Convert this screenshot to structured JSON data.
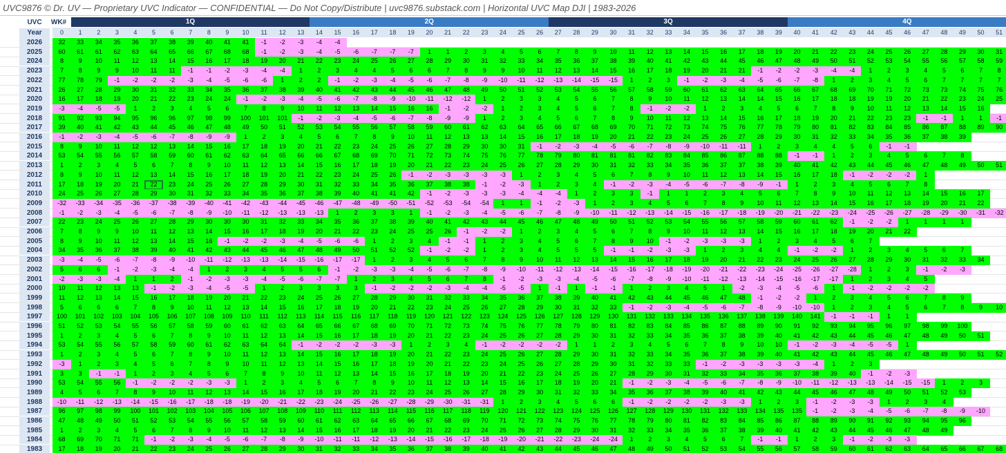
{
  "title": "UVC9876 © Dr. UV — Proprietary UVC Indicator — CONFIDENTIAL — Do Not Copy/Distribute | uvc9876.substack.com  |  Horizontal UVC Map DJI | 1983-2026",
  "header": {
    "uvc": "UVC",
    "wk": "WK#",
    "year": "Year"
  },
  "colors": {
    "positive": "#00ff00",
    "negative": "#ffa6ff",
    "quarter_dark": "#1f3864",
    "quarter_light": "#3a7cc4"
  },
  "quarters": [
    "1Q",
    "2Q",
    "3Q",
    "4Q"
  ],
  "weeks": [
    "0",
    "1",
    "2",
    "3",
    "4",
    "5",
    "6",
    "7",
    "8",
    "9",
    "10",
    "11",
    "12",
    "13",
    "14",
    "15",
    "16",
    "17",
    "18",
    "19",
    "20",
    "21",
    "22",
    "23",
    "24",
    "25",
    "26",
    "27",
    "28",
    "29",
    "30",
    "31",
    "32",
    "33",
    "34",
    "35",
    "36",
    "37",
    "38",
    "39",
    "40",
    "41",
    "42",
    "43",
    "44",
    "45",
    "46",
    "47",
    "48",
    "49",
    "50",
    "51",
    "52"
  ],
  "rows": [
    {
      "year": "2026",
      "values": "32 33 34 35 36 37 38 39 40 41 41 -1 -2 -3 -4 -4"
    },
    {
      "year": "2025",
      "values": "60 61 61 62 63 64 65 66 67 68 68 -1 -2 -3 -4 -5 -6 -7 -7 -7 1 1 2 3 4 5 6 7 8 9 10 11 12 13 14 15 16 17 18 19 20 21 22 23 24 25 26 27 28 29 30 31 32"
    },
    {
      "year": "2024",
      "values": "8 9 10 11 12 13 14 15 16 17 18 19 20 21 22 23 24 25 26 27 28 29 30 31 32 33 34 35 36 37 38 39 40 41 42 43 44 45 46 47 48 49 50 51 52 53 54 55 56 57 58 59 60"
    },
    {
      "year": "2023",
      "values": "7 8 9 9 10 11 11 -1 -1 -2 -3 -4 -4 1 2 3 4 4 5 6 6 7 8 9 9 10 11 12 13 14 15 16 17 18 19 20 21 21 -1 -2 -2 -3 -4 -4 1 2 3 4 5 6 7 8"
    },
    {
      "year": "2022",
      "values": "77 78 79 -1 -2 -2 -2 -3 -4 -5 -6 -6 1 2 2 -1 -2 -3 -4 -5 -6 -7 -8 -9 -10 -11 -12 -13 -14 -15 -15 1 2 3 -1 -2 -3 -4 -5 -6 -7 -8 1 2 3 4 5 6 7 7 7 7"
    },
    {
      "year": "2021",
      "values": "26 27 28 29 30 31 32 33 34 35 36 37 38 39 40 41 42 43 44 45 46 47 48 49 50 51 52 53 54 55 56 57 58 59 60 61 62 63 64 65 66 67 68 69 70 71 72 73 73 74 75 76 77"
    },
    {
      "year": "2020",
      "values": "16 17 18 19 20 21 22 23 24 24 -1 -2 -3 -4 -5 -6 -7 -8 -9 -10 -11 -12 -12 1 2 3 3 4 5 6 7 8 9 10 11 12 13 14 14 15 16 17 18 18 19 19 20 21 22 23 24 25 26"
    },
    {
      "year": "2019",
      "values": "-3 -4 -5 -5 1 2 3 4 5 6 7 8 9 10 11 12 13 14 15 16 16 -1 -2 -2 1 2 3 4 5 6 7 8 -1 -2 -2 1 2 3 4 5 6 7 8 9 10 11 12 13 14 15 16"
    },
    {
      "year": "2018",
      "values": "91 92 93 94 95 96 96 97 98 99 100 101 101 -1 -2 -3 -4 -5 -6 -7 -8 -9 -9 1 2 3 4 5 6 7 8 9 10 11 12 13 14 15 16 17 18 19 20 21 22 23 23 -1 -1 1 1 -1 -2 -3"
    },
    {
      "year": "2017",
      "values": "39 40 41 42 43 44 45 46 47 48 49 50 51 52 53 54 55 56 57 58 59 60 61 62 63 64 65 66 67 68 69 70 71 72 73 74 75 76 77 78 79 80 81 82 83 84 85 86 87 88 89 90 91"
    },
    {
      "year": "2016",
      "values": "-1 -2 -3 -4 -5 -6 -7 -8 -9 -9 1 2 3 4 5 6 7 8 9 10 11 12 13 13 14 15 16 17 18 19 20 21 22 23 24 25 26 27 28 29 30 31 32 33 34 35 36 37 38 39"
    },
    {
      "year": "2015",
      "values": "8 9 10 11 12 12 13 14 15 16 17 18 19 20 21 22 23 24 25 26 27 28 29 30 30 31 -1 -2 -3 -4 -5 -6 -7 -8 -9 -10 -11 -11 1 2 3 4 4 5 6 -1 -1"
    },
    {
      "year": "2014",
      "values": "53 54 55 56 57 58 59 60 61 62 63 64 65 66 66 67 68 69 70 71 72 73 74 75 76 77 78 79 80 81 81 81 82 83 84 85 86 87 88 88 -1 -1 1 2 3 4 5 6 7 8"
    },
    {
      "year": "2013",
      "values": "1 2 3 4 5 6 7 8 9 10 11 12 13 14 15 16 17 18 19 20 21 22 23 24 25 26 27 28 29 30 31 32 33 34 35 36 37 37 38 39 40 41 42 43 44 45 46 47 48 49 50 51 52 53"
    },
    {
      "year": "2012",
      "values": "8 9 10 11 12 13 14 15 16 17 18 19 20 21 22 23 24 25 26 -1 -2 -3 -3 -3 -3 1 2 3 4 5 6 7 8 9 10 11 12 13 14 15 16 17 18 -1 -2 -2 -2 1"
    },
    {
      "year": "2011",
      "values": "17 18 19 20 21 22 23 24 25 26 27 28 29 30 31 32 33 34 35 36 37 38 38 -1 -2 -3 1 2 3 4 -1 -2 -3 -4 -5 -6 -7 -8 -9 -1 1 2 3 4 5 6 7 8"
    },
    {
      "year": "2010",
      "values": "24 25 26 27 28 29 30 31 32 33 34 35 36 37 38 39 40 41 41 42 -1 -2 -3 -3 -3 -4 -4 -4 1 2 3 3 -1 1 1 2 3 4 5 6 7 8 9 10 11 12 13 14 15 16 17"
    },
    {
      "year": "2009",
      "values": "-32 -33 -34 -35 -36 -37 -38 -39 -40 -41 -42 -43 -44 -45 -46 -47 -48 -49 -50 -51 -52 -53 -54 -54 1 1 -1 -2 -3 1 2 3 4 5 6 7 8 9 10 11 12 13 14 15 16 17 18 19 20 21 22"
    },
    {
      "year": "2008",
      "values": "-1 -2 -3 -4 -5 -6 -7 -8 -9 -10 -11 -12 -13 -13 -13 1 2 3 3 1 -1 -2 -3 -4 -5 -6 -7 -8 -9 -10 -11 -12 -13 -14 -15 -16 -17 -18 -19 -20 -21 -22 -23 -24 -25 -26 -27 -28 -29 -30 -31 -32"
    },
    {
      "year": "2007",
      "values": "22 23 24 25 26 27 28 29 30 30 30 31 32 33 34 35 36 37 38 39 40 41 42 43 44 45 46 47 48 49 50 51 52 53 54 55 56 57 58 59 60 61 62 -1 -2 -2 1 1 1 1"
    },
    {
      "year": "2006",
      "values": "7 8 9 9 10 11 12 13 14 15 16 17 18 19 20 21 22 23 24 25 25 26 -1 -2 -2 1 2 3 4 5 6 7 8 9 10 11 12 13 14 15 16 17 18 19 20 21 22"
    },
    {
      "year": "2005",
      "values": "8 9 10 11 12 13 14 15 16 -1 -2 -2 -3 -4 -5 -6 -6 1 2 3 4 -1 -1 1 2 3 4 5 6 7 8 9 10 -1 -2 -3 -3 -3 1 2 3 4 5 6 7"
    },
    {
      "year": "2004",
      "values": "34 35 36 37 38 39 40 41 42 43 44 45 46 47 48 49 50 51 52 52 -1 -2 -2 1 2 3 4 5 5 5 -1 -1 -2 -3 -3 1 2 3 4 4 -1 -2 -2 1 2 3 4 5 6 7"
    },
    {
      "year": "2003",
      "values": "-3 -4 -5 -6 -7 -8 -9 -10 -11 -12 -13 -13 -14 -15 -16 -17 -17 1 2 3 4 5 6 7 8 9 10 11 12 13 14 15 16 17 18 19 20 21 22 23 24 25 26 27 28 29 30 31 32 33 34"
    },
    {
      "year": "2002",
      "values": "5 6 6 -1 -2 -3 -4 -4 1 2 3 4 5 5 6 -1 -2 -3 -3 -4 -5 -6 -7 -8 -9 -10 -11 -12 -13 -14 -15 -16 -17 -18 -19 -20 -21 -22 -23 -24 -25 -26 -27 -28 1 2 3 -1 -2 -3"
    },
    {
      "year": "2001",
      "values": "-2 -3 -3 -4 1 1 2 -1 -2 -3 -3 -4 -5 -6 -7 -7 1 2 3 4 5 6 7 8 -1 -2 -3 -3 -4 -5 -6 -7 -8 -9 -10 -11 -12 -13 -14 -15 -16 -17 -17 1 2 3 4 5"
    },
    {
      "year": "2000",
      "values": "10 11 12 13 13 -1 -2 -3 -4 -5 -5 1 2 3 3 3 3 -1 -2 -2 -2 -3 -4 -4 -5 -5 1 -1 1 -1 -1 1 2 3 4 5 1 -2 -3 -4 -5 -6 1 -1 -2 -2 -2 -2"
    },
    {
      "year": "1999",
      "values": "11 12 13 14 15 16 17 18 19 20 21 22 23 24 25 26 27 28 29 30 31 32 33 34 35 36 37 38 39 40 41 42 43 44 45 46 47 48 -1 -2 -2 1 2 3 4 5 6 7 8 9"
    },
    {
      "year": "1998",
      "values": "5 6 6 6 7 8 9 10 11 12 13 14 15 16 17 18 19 20 21 22 23 24 25 26 27 28 29 30 31 32 33 -1 -2 -3 -4 -5 -6 -7 -8 -9 -10 -10 1 2 3 4 5 6 7 8 9 10"
    },
    {
      "year": "1997",
      "values": "100 101 102 103 104 105 106 107 108 109 110 111 112 113 114 115 116 117 118 119 120 121 122 123 124 125 126 127 128 129 130 131 132 133 134 135 136 137 138 139 140 141 -1 -1 -1 1 1"
    },
    {
      "year": "1996",
      "values": "51 52 53 54 55 56 57 58 59 60 61 62 63 64 65 66 67 68 69 70 71 72 73 74 75 76 77 78 79 80 81 82 83 84 85 86 87 88 89 90 91 92 93 94 95 96 97 98 99 100"
    },
    {
      "year": "1995",
      "values": "1 2 3 4 5 6 7 8 9 10 11 12 13 14 15 16 17 18 19 20 21 22 23 24 25 26 27 28 29 30 31 32 33 34 35 36 37 38 39 40 41 42 43 44 45 46 47 48 49 50 51"
    },
    {
      "year": "1994",
      "values": "53 54 55 56 57 58 59 60 61 62 63 64 64 -1 -2 -2 -2 -3 -3 1 2 3 4 -1 -2 -2 -2 -2 1 1 2 3 4 5 6 7 8 9 10 10 -1 -2 -3 -4 -5 -5 1"
    },
    {
      "year": "1993",
      "values": "1 2 3 4 5 6 7 8 9 10 11 12 13 14 15 16 17 18 19 20 21 22 23 24 25 26 27 28 29 30 31 32 33 34 35 36 37 38 39 40 41 42 43 44 45 46 47 48 49 50 51 52 53"
    },
    {
      "year": "1992",
      "values": "-3 1 2 3 4 5 6 7 8 9 10 11 12 13 14 15 16 17 18 19 20 21 22 23 24 25 26 27 28 29 30 31 32 33 33 -1 -2 -3 -3 -3 -3 -4 1 2 3"
    },
    {
      "year": "1991",
      "values": "3 3 -1 -1 1 2 3 4 5 6 7 8 9 10 11 12 13 14 15 16 17 18 19 20 21 22 23 24 25 26 27 28 29 30 31 32 33 34 35 36 37 38 39 40 -1 -2 -3"
    },
    {
      "year": "1990",
      "values": "53 54 55 56 -1 -2 -2 -2 -3 -3 1 2 3 4 5 6 7 8 9 10 11 12 13 14 15 16 17 18 19 20 21 -1 -2 -3 -4 -5 -6 -7 -8 -9 -10 -11 -12 -13 -13 -14 -15 -15 1 2 3"
    },
    {
      "year": "1989",
      "values": "4 5 6 7 8 9 10 11 12 13 14 15 16 17 18 19 20 21 22 23 24 25 26 27 28 29 30 31 32 33 34 35 36 37 38 39 40 41 42 43 44 45 46 47 48 49 50 51 52 53"
    },
    {
      "year": "1988",
      "values": "-10 -11 -12 -13 -14 -15 -16 -17 -18 -18 -19 -20 -21 -22 -23 -24 -25 -26 -27 -28 -29 -30 -31 -31 1 2 3 4 5 6 6 -1 -2 -2 -2 -2 -3 -3 1 2 3 -1 -2 -3 -3 1 2 3 4"
    },
    {
      "year": "1987",
      "values": "96 97 98 99 100 101 102 103 104 105 106 107 108 109 110 111 112 113 114 115 116 117 118 119 120 121 122 123 124 125 126 127 128 129 130 131 132 133 134 135 135 -1 -2 -3 -4 -5 -6 -7 -8 -9 -10"
    },
    {
      "year": "1986",
      "values": "47 48 49 50 51 52 53 54 55 56 57 58 59 60 61 62 63 64 65 66 67 68 69 70 71 72 73 74 75 76 77 78 79 80 81 82 83 84 85 86 87 88 89 90 91 92 93 94 95 96"
    },
    {
      "year": "1985",
      "values": "1 2 3 4 5 6 7 8 9 10 11 12 13 14 15 16 17 18 19 20 21 22 23 24 25 26 27 28 29 30 31 32 33 34 35 36 37 38 39 40 41 42 43 44 45 46 47 48 49"
    },
    {
      "year": "1984",
      "values": "68 69 70 71 71 -1 -2 -3 -4 -5 -6 -7 -8 -9 -10 -11 -11 -12 -13 -14 -15 -16 -17 -18 -19 -20 -21 -22 -23 -24 -24 1 2 3 4 5 6 7 -1 -1 1 2 3 -1 -2 -3 -3"
    },
    {
      "year": "1983",
      "values": "17 18 19 20 21 22 23 24 25 26 27 28 29 30 31 32 33 34 35 36 37 38 39 40 41 42 43 44 45 46 47 48 49 50 51 52 53 54 55 56 57 58 59 60 61 62 63 64 65 66 67 68"
    }
  ]
}
